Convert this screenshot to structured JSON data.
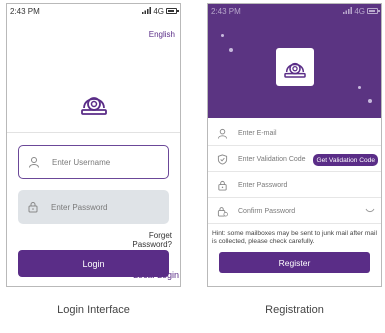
{
  "login": {
    "status": {
      "time": "2:43 PM",
      "network": "4G"
    },
    "language": "English",
    "username_placeholder": "Enter Username",
    "password_placeholder": "Enter Password",
    "forget_line1": "Forget",
    "forget_line2": "Password?",
    "login_label": "Login",
    "local_login_label": "Local Login",
    "caption": "Login Interface"
  },
  "registration": {
    "status": {
      "time": "2:43 PM",
      "network": "4G"
    },
    "email_placeholder": "Enter E-mail",
    "code_placeholder": "Enter Validation Code",
    "get_code_label": "Get Validation Code",
    "password_placeholder": "Enter Password",
    "confirm_placeholder": "Confirm Password",
    "hint": "Hint: some mailboxes may be sent to junk mail after mail is collected, please check carefully.",
    "register_label": "Register",
    "caption": "Registration"
  },
  "icons": [
    "signal-icon",
    "battery-icon",
    "camera-logo-icon",
    "user-icon",
    "lock-icon",
    "shield-check-icon",
    "eye-closed-icon"
  ],
  "colors": {
    "brand_purple": "#5a2d87",
    "header_purple": "#5b3482",
    "input_gray": "#dfe3e7"
  }
}
